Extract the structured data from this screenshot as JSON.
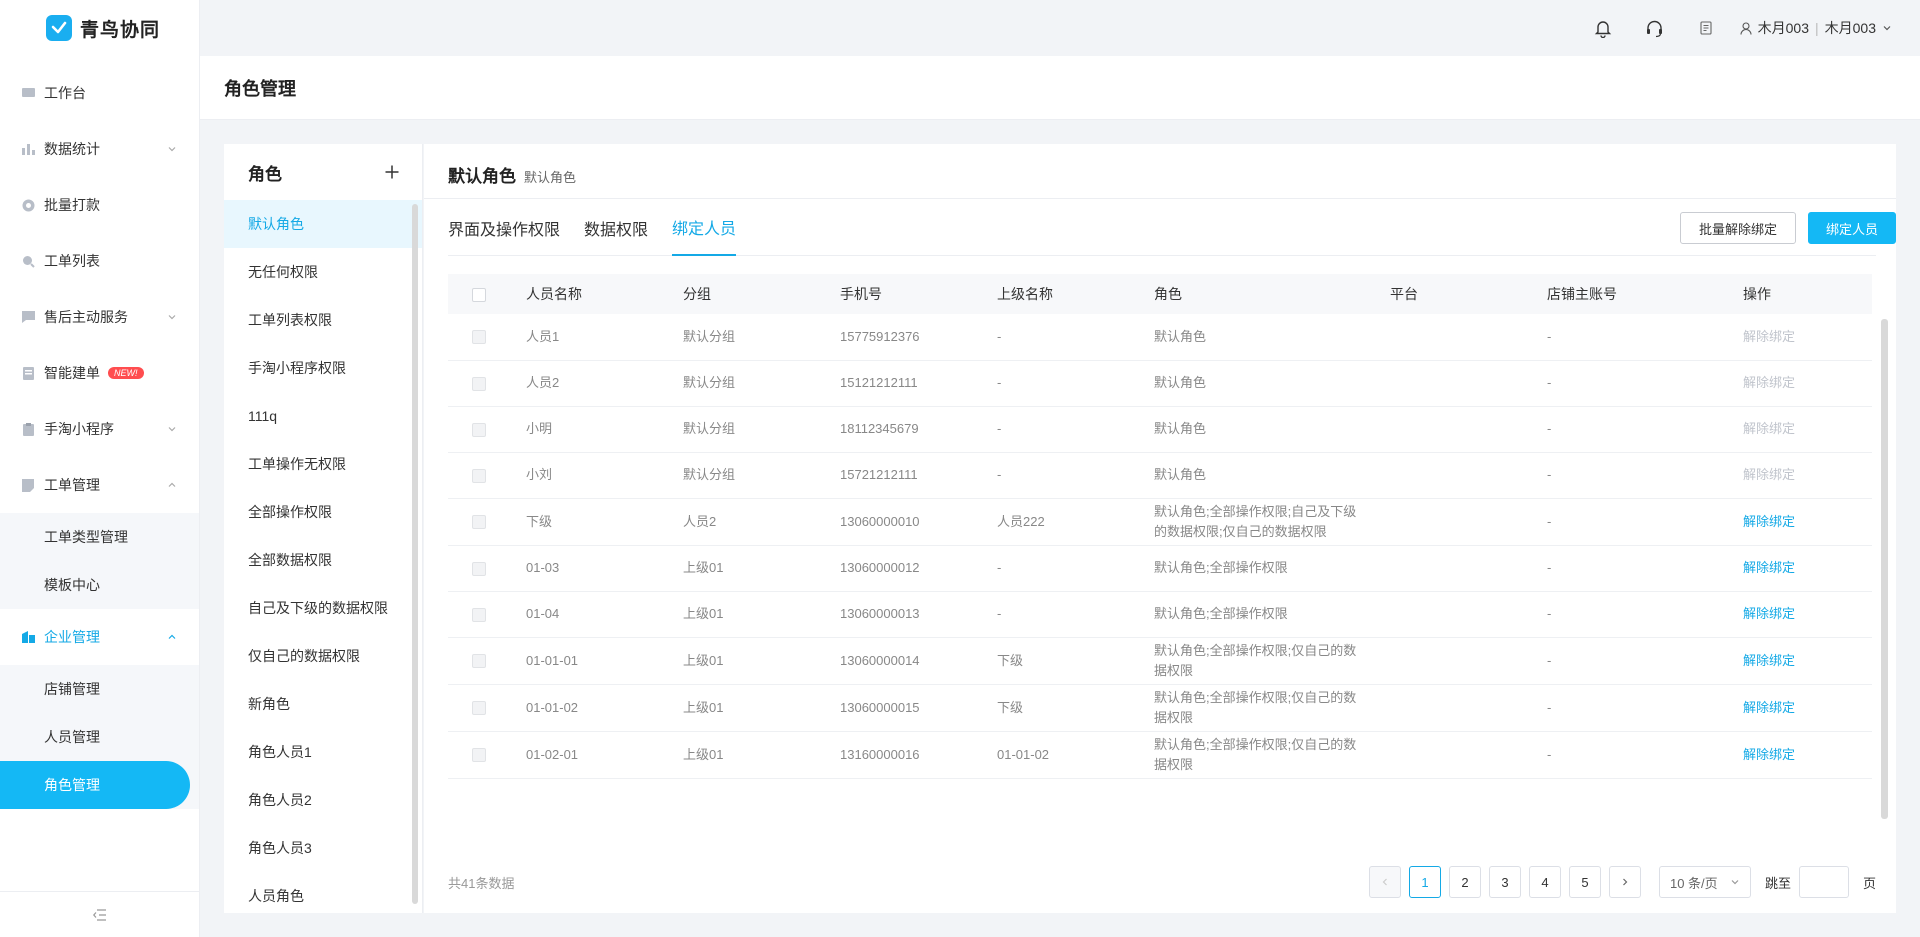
{
  "app": {
    "name": "青鸟协同"
  },
  "sidebar": {
    "items": [
      {
        "label": "工作台",
        "icon": "monitor-icon"
      },
      {
        "label": "数据统计",
        "icon": "bar-chart-icon",
        "chevron": "down"
      },
      {
        "label": "批量打款",
        "icon": "coin-icon"
      },
      {
        "label": "工单列表",
        "icon": "search-icon"
      },
      {
        "label": "售后主动服务",
        "icon": "chat-icon",
        "chevron": "down"
      },
      {
        "label": "智能建单",
        "icon": "doc-icon",
        "badge": "NEW!"
      },
      {
        "label": "手淘小程序",
        "icon": "clipboard-icon",
        "chevron": "down"
      },
      {
        "label": "工单管理",
        "icon": "ticket-icon",
        "chevron": "up"
      }
    ],
    "ticket_sub": [
      "工单类型管理",
      "模板中心"
    ],
    "enterprise": {
      "label": "企业管理",
      "icon": "building-icon"
    },
    "enterprise_sub": [
      "店铺管理",
      "人员管理",
      "角色管理"
    ],
    "collapse_icon": "collapse-icon"
  },
  "topbar": {
    "user": "木月003",
    "user_sep": "|",
    "user2": "木月003"
  },
  "page": {
    "title": "角色管理"
  },
  "roles": {
    "title": "角色",
    "items": [
      "默认角色",
      "无任何权限",
      "工单列表权限",
      "手淘小程序权限",
      "111q",
      "工单操作无权限",
      "全部操作权限",
      "全部数据权限",
      "自己及下级的数据权限",
      "仅自己的数据权限",
      "新角色",
      "角色人员1",
      "角色人员2",
      "角色人员3",
      "人员角色"
    ],
    "selected": "默认角色"
  },
  "detail": {
    "title": "默认角色",
    "subtitle": "默认角色",
    "tabs": [
      "界面及操作权限",
      "数据权限",
      "绑定人员"
    ],
    "active_tab": "绑定人员",
    "batch_unbind": "批量解除绑定",
    "bind": "绑定人员"
  },
  "table": {
    "headers": [
      "人员名称",
      "分组",
      "手机号",
      "上级名称",
      "角色",
      "平台",
      "店铺主账号",
      "操作"
    ],
    "rows": [
      {
        "name": "人员1",
        "group": "默认分组",
        "phone": "15775912376",
        "superior": "-",
        "role": "默认角色",
        "platform": "",
        "main": "-",
        "op": "解除绑定",
        "disabled": true
      },
      {
        "name": "人员2",
        "group": "默认分组",
        "phone": "15121212111",
        "superior": "-",
        "role": "默认角色",
        "platform": "",
        "main": "-",
        "op": "解除绑定",
        "disabled": true
      },
      {
        "name": "小明",
        "group": "默认分组",
        "phone": "18112345679",
        "superior": "-",
        "role": "默认角色",
        "platform": "",
        "main": "-",
        "op": "解除绑定",
        "disabled": true
      },
      {
        "name": "小刘",
        "group": "默认分组",
        "phone": "15721212111",
        "superior": "-",
        "role": "默认角色",
        "platform": "",
        "main": "-",
        "op": "解除绑定",
        "disabled": true
      },
      {
        "name": "下级",
        "group": "人员2",
        "phone": "13060000010",
        "superior": "人员222",
        "role": "默认角色;全部操作权限;自己及下级的数据权限;仅自己的数据权限",
        "platform": "",
        "main": "-",
        "op": "解除绑定",
        "disabled": false
      },
      {
        "name": "01-03",
        "group": "上级01",
        "phone": "13060000012",
        "superior": "-",
        "role": "默认角色;全部操作权限",
        "platform": "",
        "main": "-",
        "op": "解除绑定",
        "disabled": false
      },
      {
        "name": "01-04",
        "group": "上级01",
        "phone": "13060000013",
        "superior": "-",
        "role": "默认角色;全部操作权限",
        "platform": "",
        "main": "-",
        "op": "解除绑定",
        "disabled": false
      },
      {
        "name": "01-01-01",
        "group": "上级01",
        "phone": "13060000014",
        "superior": "下级",
        "role": "默认角色;全部操作权限;仅自己的数据权限",
        "platform": "",
        "main": "-",
        "op": "解除绑定",
        "disabled": false
      },
      {
        "name": "01-01-02",
        "group": "上级01",
        "phone": "13060000015",
        "superior": "下级",
        "role": "默认角色;全部操作权限;仅自己的数据权限",
        "platform": "",
        "main": "-",
        "op": "解除绑定",
        "disabled": false
      },
      {
        "name": "01-02-01",
        "group": "上级01",
        "phone": "13160000016",
        "superior": "01-01-02",
        "role": "默认角色;全部操作权限;仅自己的数据权限",
        "platform": "",
        "main": "-",
        "op": "解除绑定",
        "disabled": false
      }
    ]
  },
  "pagination": {
    "total": "共41条数据",
    "pages": [
      "1",
      "2",
      "3",
      "4",
      "5"
    ],
    "current": "1",
    "page_size": "10 条/页",
    "jump_label": "跳至",
    "page_unit": "页"
  },
  "colors": {
    "accent": "#14b8f5",
    "danger": "#ff4d4f"
  }
}
